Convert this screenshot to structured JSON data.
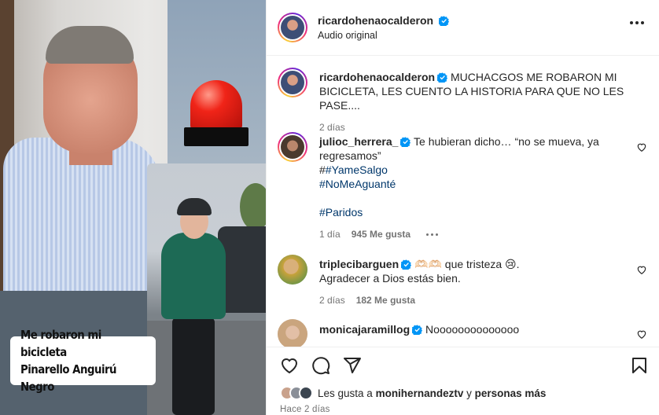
{
  "media": {
    "caption_line1": "Me robaron mi bicicleta",
    "caption_line2": "Pinarello Anguirú Negro"
  },
  "header": {
    "username": "ricardohenaocalderon",
    "subtitle": "Audio original",
    "more_icon": "more-horizontal-icon"
  },
  "caption_post": {
    "username": "ricardohenaocalderon",
    "text_line1": "MUCHACGOS ME ROBARON MI",
    "text_line2": "BICICLETA, LES CUENTO LA HISTORIA PARA QUE NO LES PASE....",
    "time": "2 días"
  },
  "comments": [
    {
      "username": "julioc_herrera_",
      "text_line1": "Te hubieran dicho… “no se mueva, ya",
      "text_line2": "regresamos”",
      "hash_prefix": "#",
      "tag1": "#YameSalgo",
      "tag2": "#NoMeAguanté",
      "tag3": "#Paridos",
      "time": "1 día",
      "likes": "945 Me gusta"
    },
    {
      "username": "triplecibarguen",
      "text_line1": "🫶🏻🫶🏻 que tristeza 😢.",
      "text_line2": "Agradecer a Dios estás bien.",
      "time": "2 días",
      "likes": "182 Me gusta"
    },
    {
      "username": "monicajaramillog",
      "text_line1": "Noooooooooooooo"
    }
  ],
  "footer": {
    "likes_prefix": "Les gusta a ",
    "likes_user": "monihernandeztv",
    "likes_and": " y ",
    "likes_others": "personas más",
    "time_ago": "Hace 2 días"
  },
  "colors": {
    "verified": "#0095f6",
    "link": "#00376b",
    "muted": "#737373"
  }
}
